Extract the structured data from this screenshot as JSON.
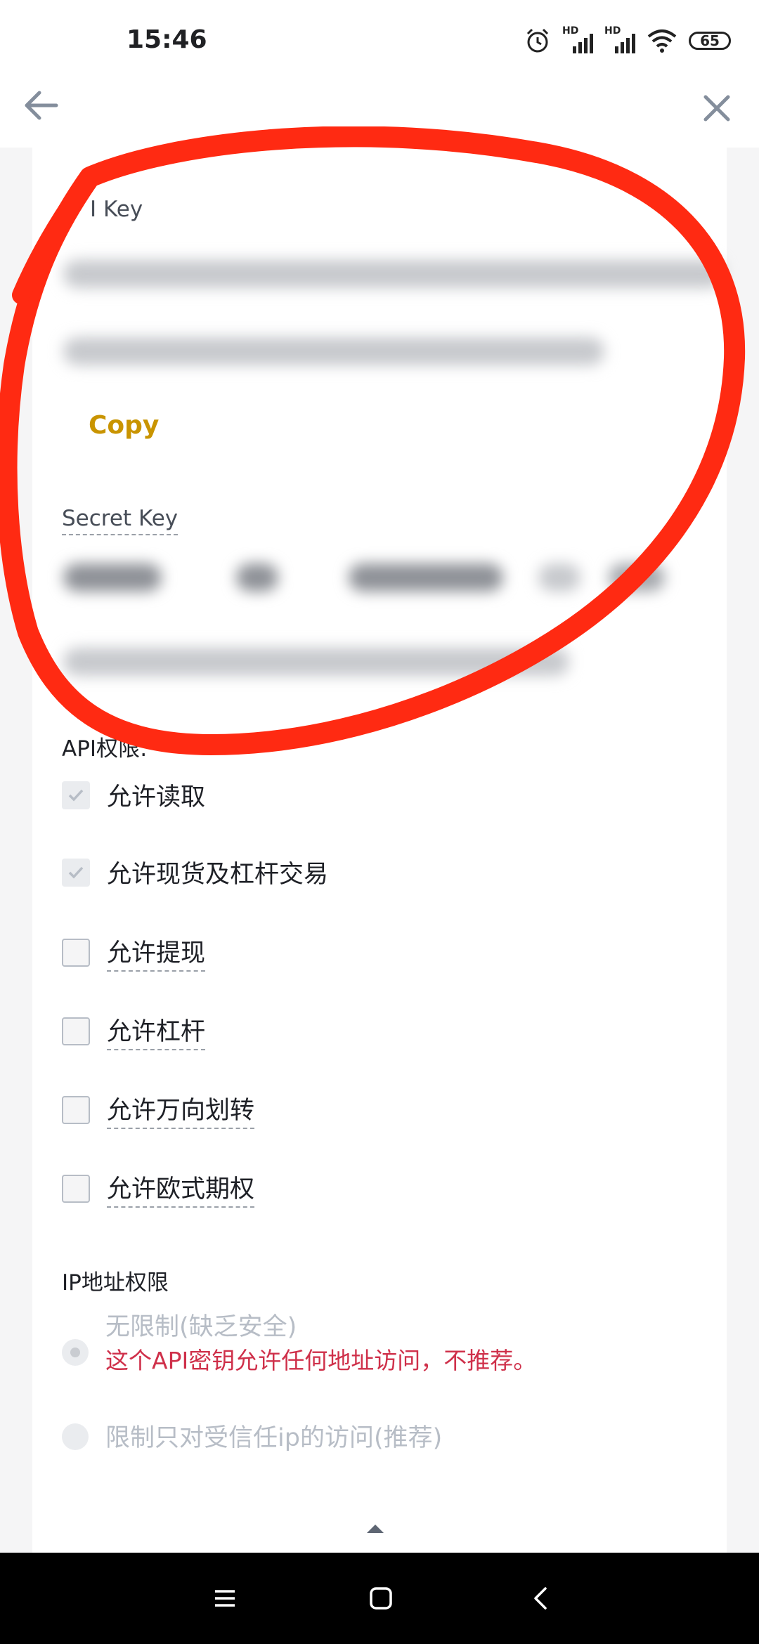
{
  "status_bar": {
    "time": "15:46",
    "hd1": "HD",
    "hd2": "HD",
    "battery": "65"
  },
  "nav": {
    "back_icon": "arrow-left-icon",
    "close_icon": "close-icon"
  },
  "api_key": {
    "label": "I Key",
    "copy_label": "Copy"
  },
  "secret_key": {
    "label": "Secret Key"
  },
  "permissions": {
    "title": "API权限:",
    "items": [
      {
        "label": "允许读取",
        "checked": true
      },
      {
        "label": "允许现货及杠杆交易",
        "checked": true
      },
      {
        "label": "允许提现",
        "checked": false
      },
      {
        "label": "允许杠杆",
        "checked": false
      },
      {
        "label": "允许万向划转",
        "checked": false
      },
      {
        "label": "允许欧式期权",
        "checked": false
      }
    ]
  },
  "ip": {
    "title": "IP地址权限",
    "unrestricted": "无限制(缺乏安全)",
    "warning": "这个API密钥允许任何地址访问，不推荐。",
    "restricted": "限制只对受信任ip的访问(推荐)"
  },
  "colors": {
    "accent": "#c99400",
    "warning": "#cf304a",
    "annotation": "#ff2a12"
  }
}
